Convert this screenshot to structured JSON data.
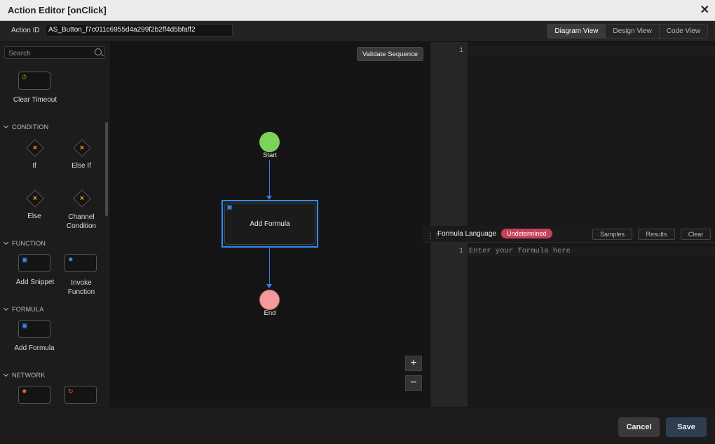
{
  "window": {
    "title": "Action Editor [onClick]"
  },
  "toolbar": {
    "action_id_label": "Action ID",
    "action_id_value": "AS_Button_f7c011c6955d4a299f2b2ff4d5bfaff2",
    "views": [
      "Diagram View",
      "Design View",
      "Code View"
    ],
    "active_view": "Diagram View"
  },
  "palette": {
    "search_placeholder": "Search",
    "items_top": [
      {
        "label": "Clear Timeout",
        "icon": "timer-icon",
        "color": "#e3a02a"
      }
    ],
    "sections": {
      "condition": {
        "title": "CONDITION",
        "items": [
          "If",
          "Else If",
          "Else",
          "Channel Condition"
        ]
      },
      "function": {
        "title": "FUNCTION",
        "items": [
          "Add Snippet",
          "Invoke Function"
        ]
      },
      "formula": {
        "title": "FORMULA",
        "items": [
          "Add Formula"
        ]
      },
      "network": {
        "title": "NETWORK",
        "items": []
      }
    }
  },
  "canvas": {
    "validate_label": "Validate Sequence",
    "start_label": "Start",
    "node_label": "Add Formula",
    "end_label": "End",
    "zoom_in": "+",
    "zoom_out": "−"
  },
  "code_editor": {
    "line_number": "1"
  },
  "formula": {
    "language_label": "Formula Language",
    "language_badge": "Undetermined",
    "samples": "Samples",
    "results": "Results",
    "clear": "Clear",
    "line_number": "1",
    "placeholder": "Enter your formula here"
  },
  "footer": {
    "cancel": "Cancel",
    "save": "Save"
  },
  "colors": {
    "accent": "#2f8df5",
    "start": "#7cd25a",
    "end": "#f59a9a",
    "badge": "#c8405a"
  }
}
